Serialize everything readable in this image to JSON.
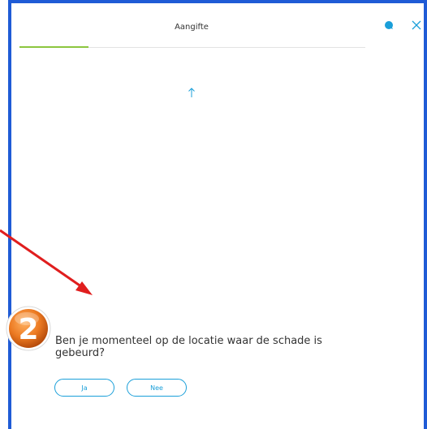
{
  "header": {
    "title": "Aangifte",
    "chat_icon": "chat-bubble-icon",
    "close_icon": "close-icon"
  },
  "progress": {
    "fraction": 0.2
  },
  "annotation": {
    "step_number": "2"
  },
  "question": {
    "text": "Ben je momenteel op de locatie waar de schade is gebeurd?"
  },
  "answers": [
    {
      "label": "Ja"
    },
    {
      "label": "Nee"
    }
  ],
  "colors": {
    "frame": "#1f5bd6",
    "accent": "#1a9fd9",
    "progress": "#8cc63f",
    "annotation_arrow": "#e01e1e",
    "badge": "#e8731f"
  }
}
